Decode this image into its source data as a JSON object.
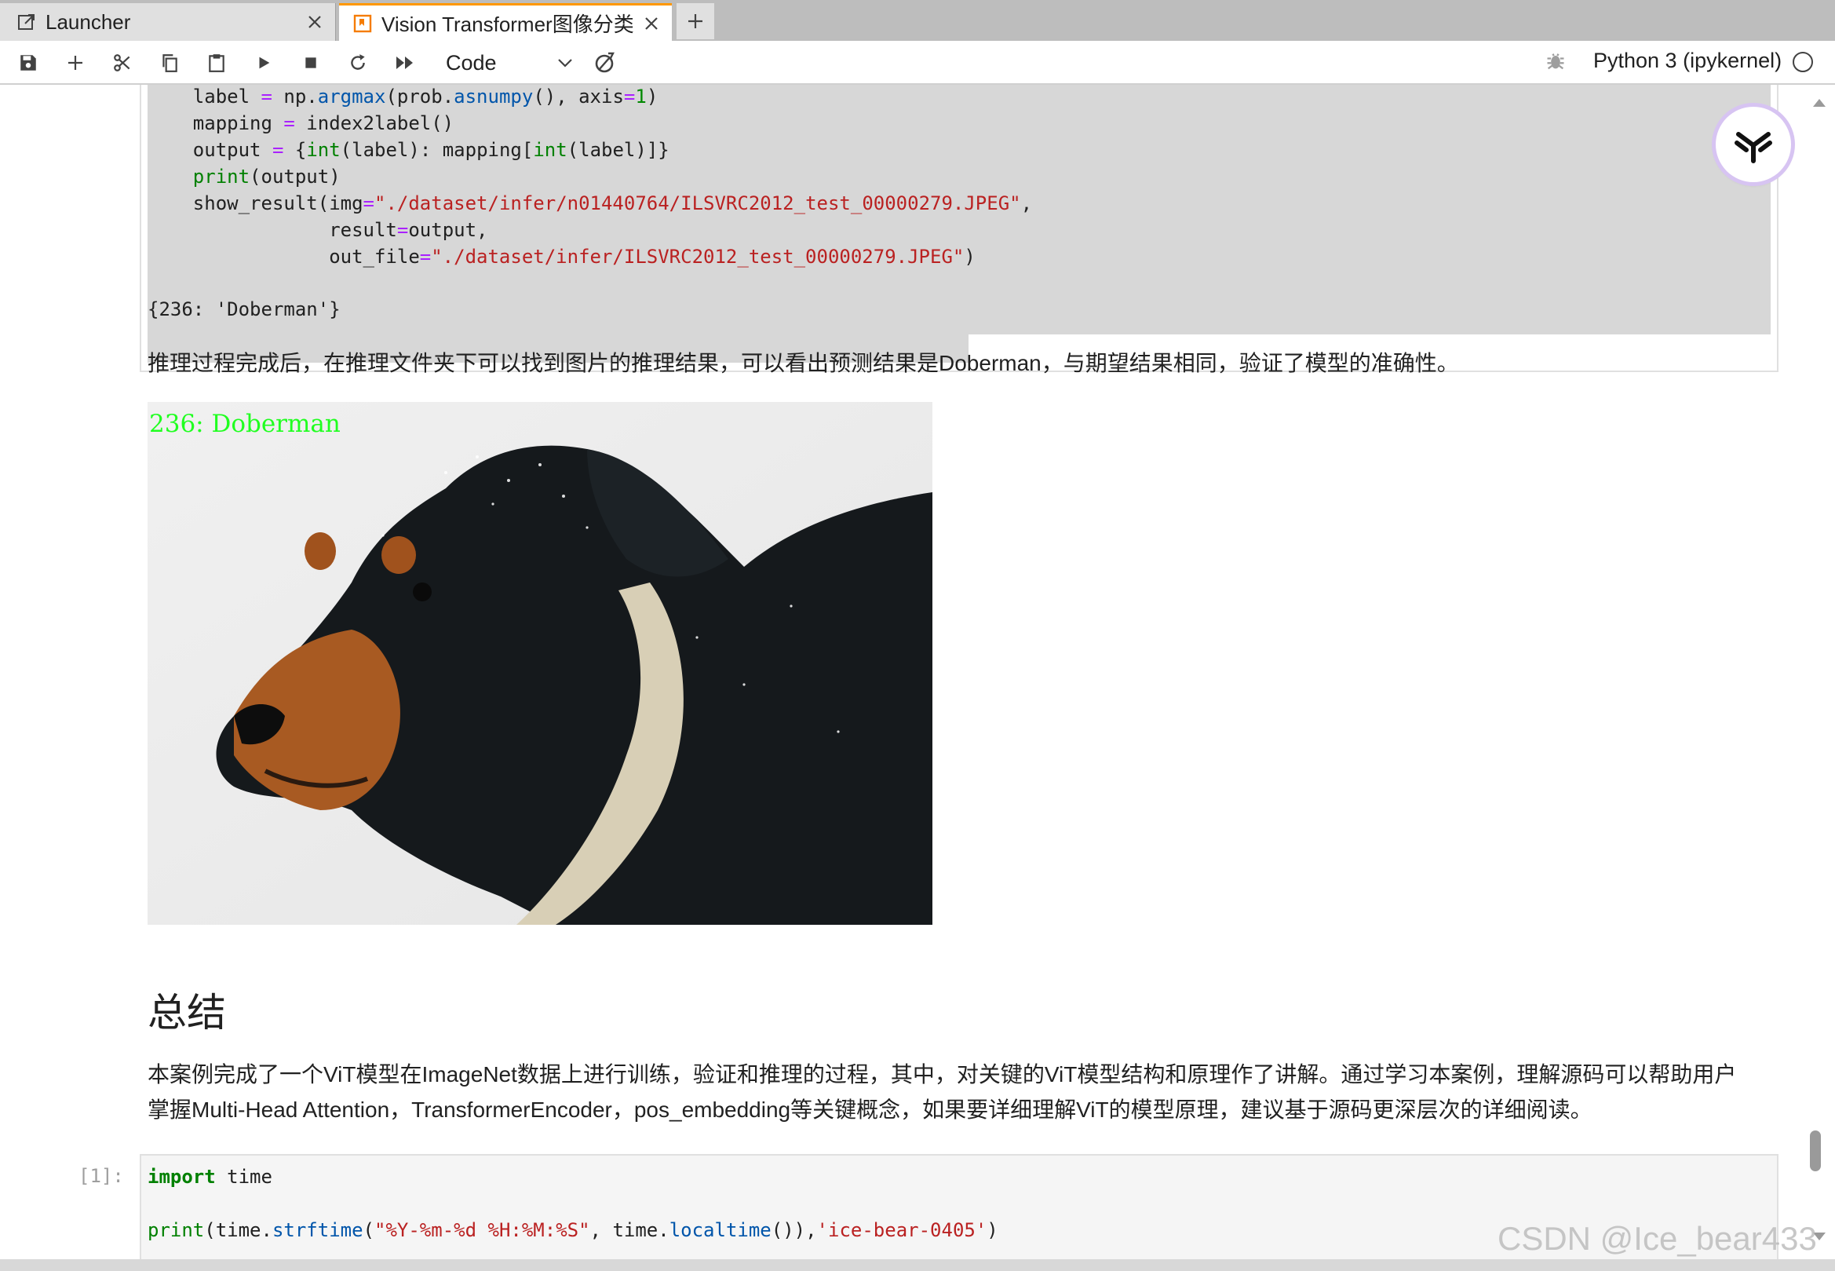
{
  "tabs": [
    {
      "label": "Launcher",
      "icon": "external-link-icon"
    },
    {
      "label": "Vision Transformer图像分类.i",
      "icon": "notebook-icon",
      "active": true
    }
  ],
  "toolbar": {
    "cell_type": "Code",
    "kernel_name": "Python 3 (ipykernel)"
  },
  "cell1": {
    "output": "{236: 'Doberman'}"
  },
  "markdown": {
    "result_text": "推理过程完成后，在推理文件夹下可以找到图片的推理结果，可以看出预测结果是Doberman，与期望结果相同，验证了模型的准确性。",
    "image_label": "236: Doberman",
    "heading": "总结",
    "summary_line1": "本案例完成了一个ViT模型在ImageNet数据上进行训练，验证和推理的过程，其中，对关键的ViT模型结构和原理作了讲解。通过学习本案例，理解源码可以帮助用户",
    "summary_line2": "掌握Multi-Head Attention，TransformerEncoder，pos_embedding等关键概念，如果要详细理解ViT的模型原理，建议基于源码更深层次的详细阅读。"
  },
  "cell2": {
    "prompt": "[1]:"
  },
  "watermark": "CSDN @Ice_bear433",
  "colors": {
    "accent_tab": "#ff9800",
    "tabbar_bg": "#bdbdbd",
    "image_label": "#20ff20"
  }
}
